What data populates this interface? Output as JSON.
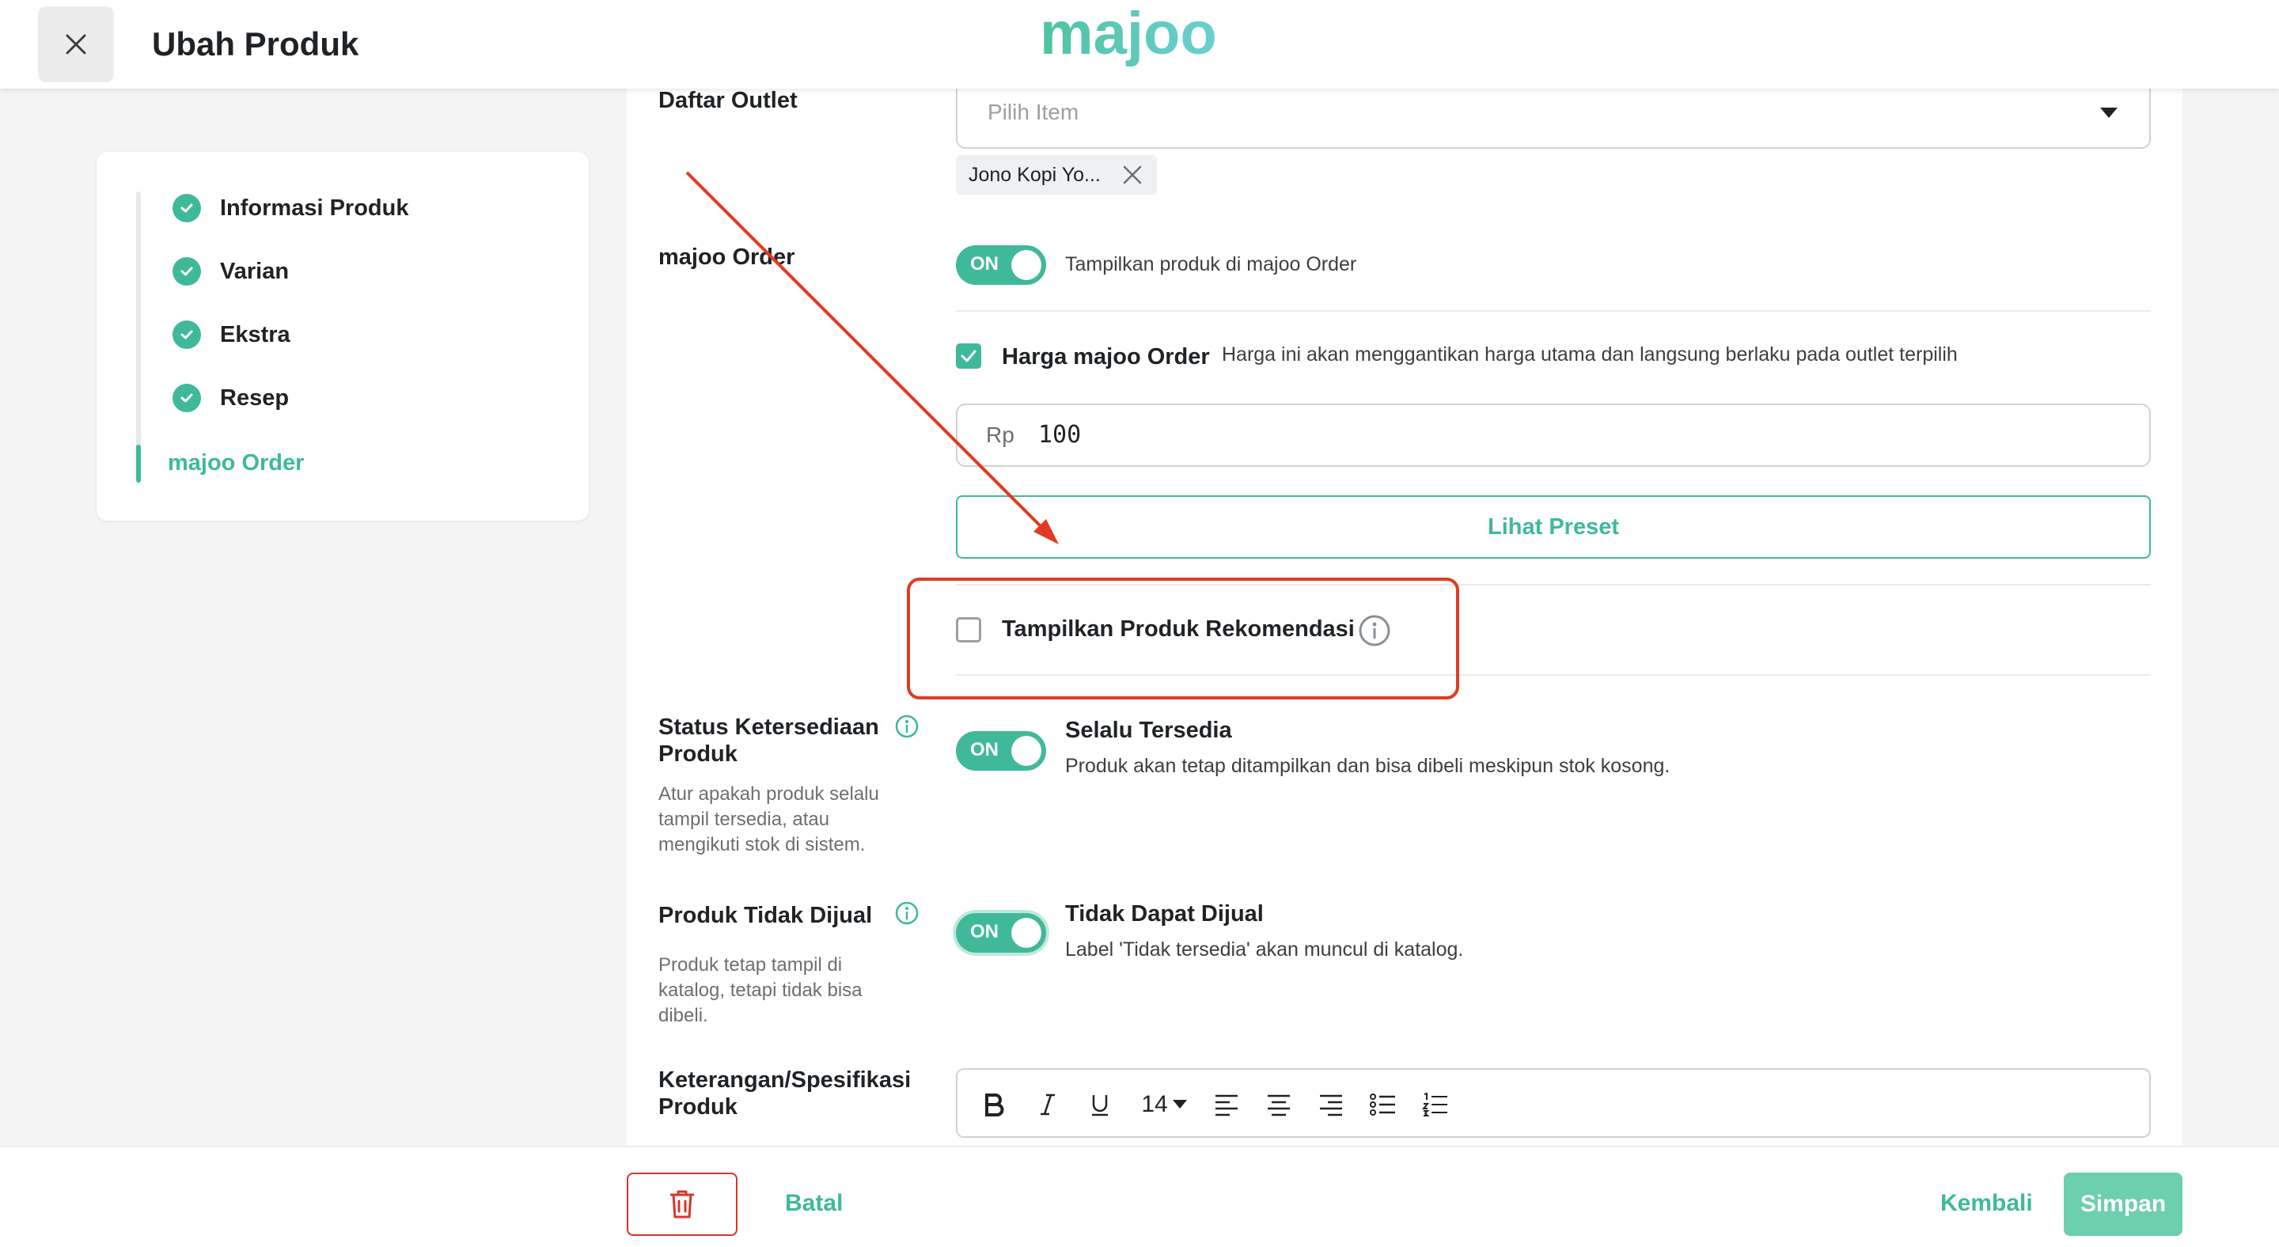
{
  "header": {
    "title": "Ubah Produk",
    "logo_text": "majoo"
  },
  "stepper": {
    "steps": [
      {
        "label": "Informasi Produk",
        "status": "done"
      },
      {
        "label": "Varian",
        "status": "done"
      },
      {
        "label": "Ekstra",
        "status": "done"
      },
      {
        "label": "Resep",
        "status": "done"
      },
      {
        "label": "majoo Order",
        "status": "active"
      }
    ]
  },
  "outlet": {
    "label": "Daftar Outlet",
    "placeholder": "Pilih Item",
    "chip": "Jono Kopi Yo..."
  },
  "majoo_order": {
    "label": "majoo Order",
    "toggle": "ON",
    "toggle_desc": "Tampilkan produk di majoo Order",
    "price_label": "Harga majoo Order",
    "price_desc": "Harga ini akan menggantikan harga utama dan langsung berlaku pada outlet terpilih",
    "currency": "Rp",
    "price_value": "100",
    "preset_button": "Lihat Preset",
    "recommend_label": "Tampilkan Produk Rekomendasi"
  },
  "availability": {
    "label": "Status Ketersediaan Produk",
    "desc": "Atur apakah produk selalu tampil tersedia, atau mengikuti stok di sistem.",
    "toggle": "ON",
    "title": "Selalu Tersedia",
    "subtitle": "Produk akan tetap ditampilkan dan bisa dibeli meskipun stok kosong."
  },
  "not_sold": {
    "label": "Produk Tidak Dijual",
    "desc": "Produk tetap tampil di katalog, tetapi tidak bisa dibeli.",
    "toggle": "ON",
    "title": "Tidak Dapat Dijual",
    "subtitle": "Label 'Tidak tersedia' akan muncul di katalog."
  },
  "specification": {
    "label": "Keterangan/Spesifikasi Produk",
    "font_size": "14"
  },
  "footer": {
    "cancel": "Batal",
    "back": "Kembali",
    "save": "Simpan"
  },
  "colors": {
    "accent": "#3fb99a",
    "annotation": "#e23a22",
    "danger": "#d9342b"
  }
}
